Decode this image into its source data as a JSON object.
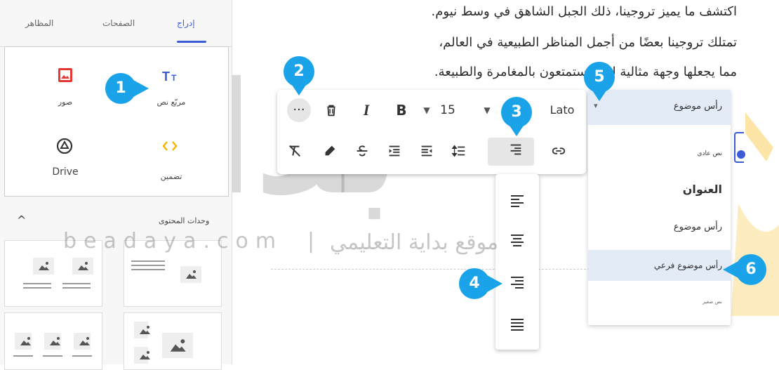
{
  "sidebar": {
    "tabs": [
      {
        "label": "إدراج",
        "active": true
      },
      {
        "label": "الصفحات",
        "active": false
      },
      {
        "label": "المظاهر",
        "active": false
      }
    ],
    "insert": {
      "text_box_label": "مربّع نص",
      "images_label": "صور",
      "embed_label": "تضمين",
      "drive_label": "Drive"
    },
    "content_units_label": "وحدات المحتوى"
  },
  "document": {
    "lines": [
      "اكتشف ما يميز تروجينا، ذلك الجبل الشاهق في وسط نيوم.",
      "تمتلك تروجينا بعضًا من أجمل المناظر الطبيعية في العالم،",
      "مما يجعلها وجهة مثالية لمن يستمتعون بالمغامرة والطبيعة."
    ]
  },
  "toolbar": {
    "font_name": "Lato",
    "font_size": "15",
    "bold_label": "B",
    "italic_label": "I"
  },
  "style_list": {
    "current": "رأس موضوع",
    "items": [
      {
        "label": "نص عادي"
      },
      {
        "label": "العنوان"
      },
      {
        "label": "رأس موضوع"
      },
      {
        "label": "رأس موضوع فرعي"
      },
      {
        "label": "نص صغير"
      }
    ]
  },
  "badges": [
    "1",
    "2",
    "3",
    "4",
    "5",
    "6"
  ],
  "watermark": {
    "arabic_logo": "بداية",
    "url": "beadaya.com",
    "separator": "|",
    "site_name": "موقع بداية التعليمي"
  },
  "colors": {
    "accent": "#3b5bd9",
    "badge": "#1aa3e8",
    "highlight": "#e3ebf7",
    "images_icon": "#e53935",
    "text_icon": "#3b5bd9",
    "embed_icon": "#f6b400"
  },
  "icons": {
    "text_box": "text-box-icon",
    "images": "image-icon",
    "drive": "drive-icon",
    "embed": "embed-code-icon",
    "more": "more-horizontal-icon",
    "delete": "trash-icon",
    "clear_format": "clear-formatting-icon",
    "highlight": "highlighter-icon",
    "strikethrough": "strikethrough-icon",
    "indent": "indent-icon",
    "outdent": "outdent-icon",
    "line_spacing": "line-spacing-icon",
    "align": "align-right-icon",
    "link": "link-icon"
  }
}
